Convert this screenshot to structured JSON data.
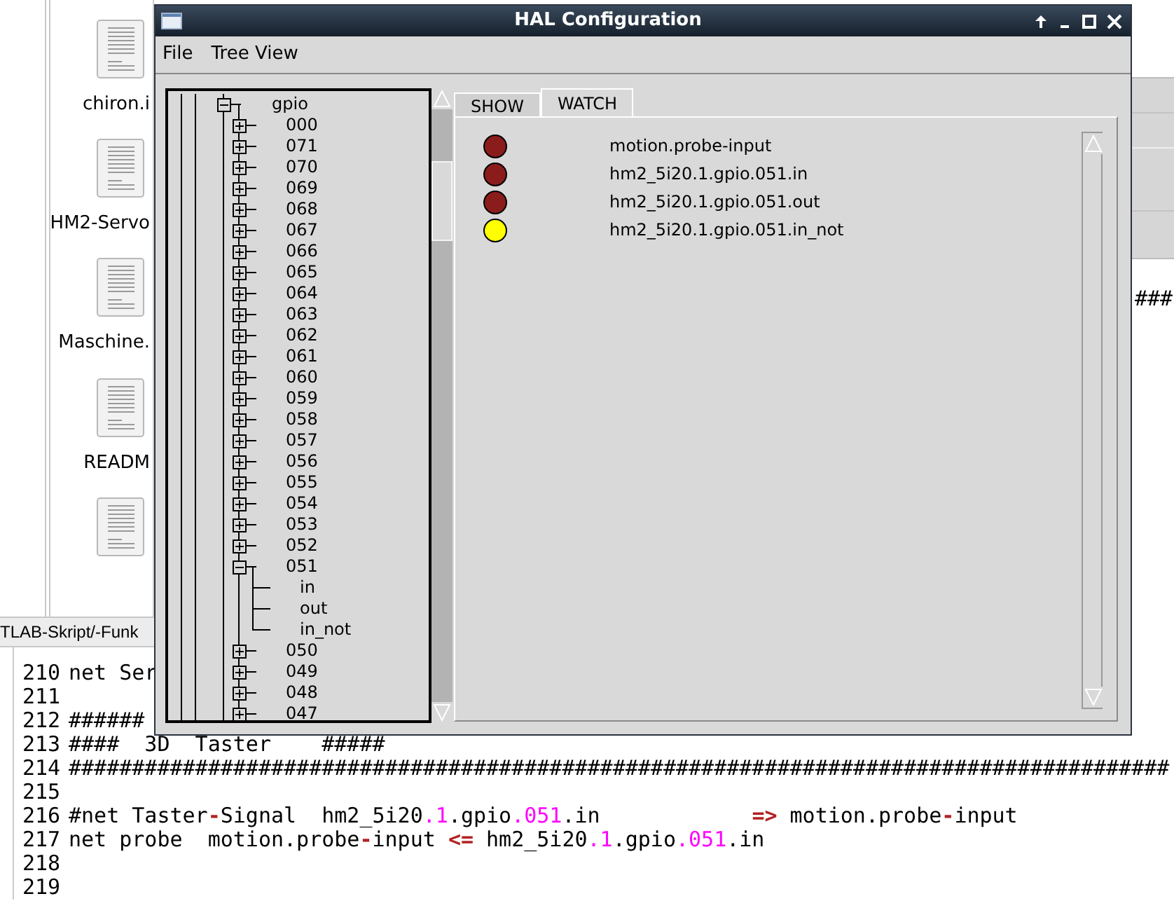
{
  "desktop": {
    "files": [
      {
        "kind": "file",
        "label": "chiron.i"
      },
      {
        "kind": "file",
        "label": "HM2-Servo"
      },
      {
        "kind": "file",
        "label": "Maschine."
      },
      {
        "kind": "file",
        "label": "READM"
      },
      {
        "kind": "file"
      }
    ],
    "side_text": "###"
  },
  "editor": {
    "tab": "TLAB-Skript/-Funk",
    "lines": [
      {
        "number": "210",
        "segments": [
          {
            "kind": "plain",
            "text": "net Ser"
          }
        ]
      },
      {
        "number": "211"
      },
      {
        "number": "212",
        "segments": [
          {
            "kind": "plain",
            "text": "######"
          }
        ]
      },
      {
        "number": "213",
        "segments": [
          {
            "kind": "plain",
            "text": "####  3D  Taster    #####"
          }
        ]
      },
      {
        "number": "214",
        "segments": [
          {
            "kind": "plain",
            "text": "#######################################################################################"
          }
        ]
      },
      {
        "number": "215"
      },
      {
        "number": "216",
        "segments": [
          {
            "kind": "plain",
            "text": "#net Taster"
          },
          {
            "kind": "op",
            "text": "-"
          },
          {
            "kind": "plain",
            "text": "Signal  hm2_5i20"
          },
          {
            "kind": "num",
            "text": ".1"
          },
          {
            "kind": "plain",
            "text": ".gpio"
          },
          {
            "kind": "num",
            "text": ".051"
          },
          {
            "kind": "plain",
            "text": ".in            "
          },
          {
            "kind": "op",
            "text": "=>"
          },
          {
            "kind": "plain",
            "text": " motion.probe"
          },
          {
            "kind": "op",
            "text": "-"
          },
          {
            "kind": "plain",
            "text": "input"
          }
        ]
      },
      {
        "number": "217",
        "segments": [
          {
            "kind": "plain",
            "text": "net probe  motion.probe"
          },
          {
            "kind": "op",
            "text": "-"
          },
          {
            "kind": "plain",
            "text": "input "
          },
          {
            "kind": "op",
            "text": "<="
          },
          {
            "kind": "plain",
            "text": " hm2_5i20"
          },
          {
            "kind": "num",
            "text": ".1"
          },
          {
            "kind": "plain",
            "text": ".gpio"
          },
          {
            "kind": "num",
            "text": ".051"
          },
          {
            "kind": "plain",
            "text": ".in"
          }
        ]
      },
      {
        "number": "218"
      },
      {
        "number": "219"
      }
    ]
  },
  "window": {
    "title": "HAL Configuration",
    "menu": [
      "File",
      "Tree View"
    ],
    "tree": {
      "nodes": [
        {
          "label": "gpio",
          "expanded": true,
          "children": [
            {
              "label": "000",
              "expanded": false
            },
            {
              "label": "071",
              "expanded": false
            },
            {
              "label": "070",
              "expanded": false
            },
            {
              "label": "069",
              "expanded": false
            },
            {
              "label": "068",
              "expanded": false
            },
            {
              "label": "067",
              "expanded": false
            },
            {
              "label": "066",
              "expanded": false
            },
            {
              "label": "065",
              "expanded": false
            },
            {
              "label": "064",
              "expanded": false
            },
            {
              "label": "063",
              "expanded": false
            },
            {
              "label": "062",
              "expanded": false
            },
            {
              "label": "061",
              "expanded": false
            },
            {
              "label": "060",
              "expanded": false
            },
            {
              "label": "059",
              "expanded": false
            },
            {
              "label": "058",
              "expanded": false
            },
            {
              "label": "057",
              "expanded": false
            },
            {
              "label": "056",
              "expanded": false
            },
            {
              "label": "055",
              "expanded": false
            },
            {
              "label": "054",
              "expanded": false
            },
            {
              "label": "053",
              "expanded": false
            },
            {
              "label": "052",
              "expanded": false
            },
            {
              "label": "051",
              "expanded": true,
              "children": [
                {
                  "label": "in"
                },
                {
                  "label": "out"
                },
                {
                  "label": "in_not"
                }
              ]
            },
            {
              "label": "050",
              "expanded": false
            },
            {
              "label": "049",
              "expanded": false
            },
            {
              "label": "048",
              "expanded": false
            },
            {
              "label": "047",
              "expanded": false
            }
          ]
        }
      ]
    },
    "tabs": [
      {
        "label": "SHOW",
        "selected": false
      },
      {
        "label": "WATCH",
        "selected": true
      }
    ],
    "watch": [
      {
        "label": "motion.probe-input",
        "on": false
      },
      {
        "label": "hm2_5i20.1.gpio.051.in",
        "on": false
      },
      {
        "label": "hm2_5i20.1.gpio.051.out",
        "on": false
      },
      {
        "label": "hm2_5i20.1.gpio.051.in_not",
        "on": true
      }
    ]
  }
}
